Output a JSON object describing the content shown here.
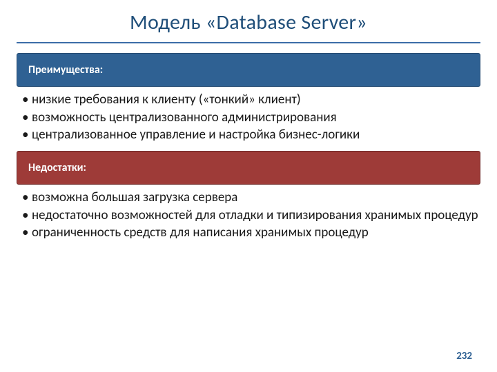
{
  "title": "Модель «Database Server»",
  "advantages": {
    "heading": "Преимущества:",
    "items": [
      "низкие требования к клиенту («тонкий» клиент)",
      "возможность централизованного администрирования",
      "централизованное управление и настройка бизнес-логики"
    ]
  },
  "disadvantages": {
    "heading": "Недостатки:",
    "items": [
      "возможна большая загрузка сервера",
      "недостаточно возможностей для отладки и типизирования хранимых процедур",
      "ограниченность средств для написания хранимых процедур"
    ]
  },
  "page_number": "232"
}
